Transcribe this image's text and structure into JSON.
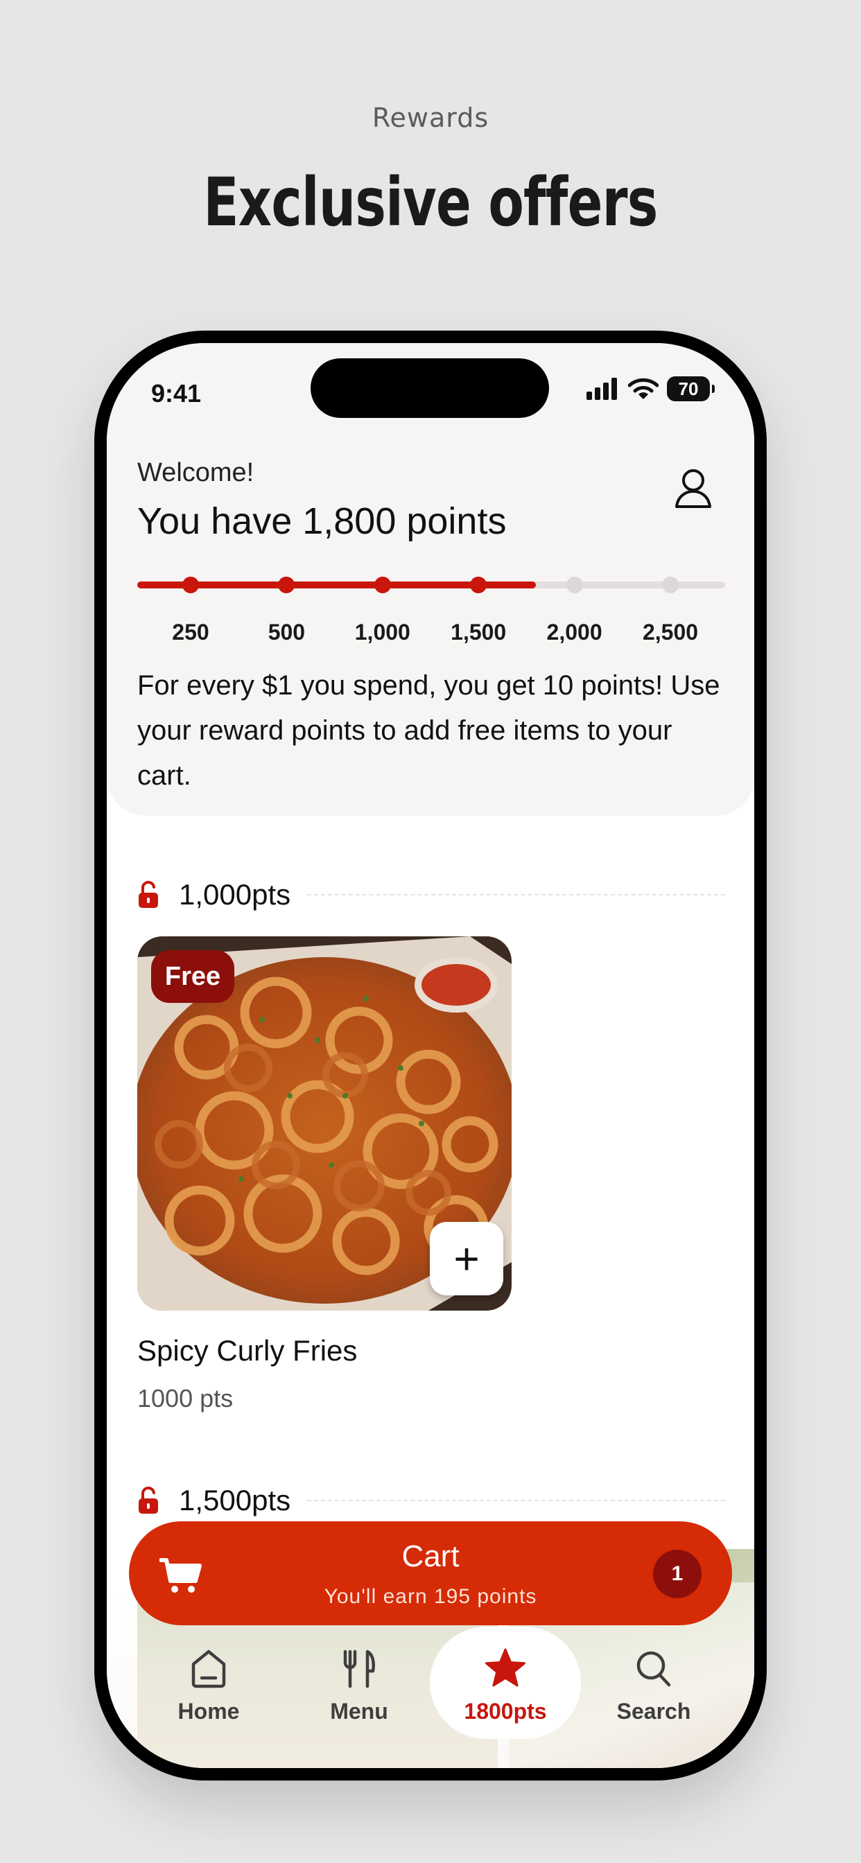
{
  "page": {
    "kicker": "Rewards",
    "headline": "Exclusive offers"
  },
  "status_bar": {
    "time": "9:41",
    "battery": "70"
  },
  "header": {
    "welcome": "Welcome!",
    "points_title": "You have 1,800 points",
    "points_value": 1800,
    "explanation": "For every $1 you spend, you get 10 points! Use your reward points to add free items to your cart."
  },
  "progress": {
    "max": 2500,
    "current": 1800,
    "milestones": [
      {
        "label": "250",
        "value": 250,
        "reached": true
      },
      {
        "label": "500",
        "value": 500,
        "reached": true
      },
      {
        "label": "1,000",
        "value": 1000,
        "reached": true
      },
      {
        "label": "1,500",
        "value": 1500,
        "reached": true
      },
      {
        "label": "2,000",
        "value": 2000,
        "reached": false
      },
      {
        "label": "2,500",
        "value": 2500,
        "reached": false
      }
    ]
  },
  "sections": [
    {
      "label": "1,000pts",
      "icon": "unlock-icon"
    },
    {
      "label": "1,500pts",
      "icon": "unlock-icon"
    }
  ],
  "items": [
    {
      "badge": "Free",
      "name": "Spicy Curly Fries",
      "points": "1000 pts",
      "add": "+"
    }
  ],
  "cart": {
    "title": "Cart",
    "subtitle": "You'll earn 195 points",
    "count": "1"
  },
  "nav": [
    {
      "label": "Home",
      "icon": "home-icon"
    },
    {
      "label": "Menu",
      "icon": "fork-knife-icon"
    },
    {
      "label": "1800pts",
      "icon": "star-icon",
      "active": true
    },
    {
      "label": "Search",
      "icon": "search-icon"
    }
  ],
  "colors": {
    "brand_red": "#c8160d",
    "cart_orange": "#d52b06",
    "badge_dark_red": "#8c0f0b",
    "background": "#e6e6e7"
  }
}
